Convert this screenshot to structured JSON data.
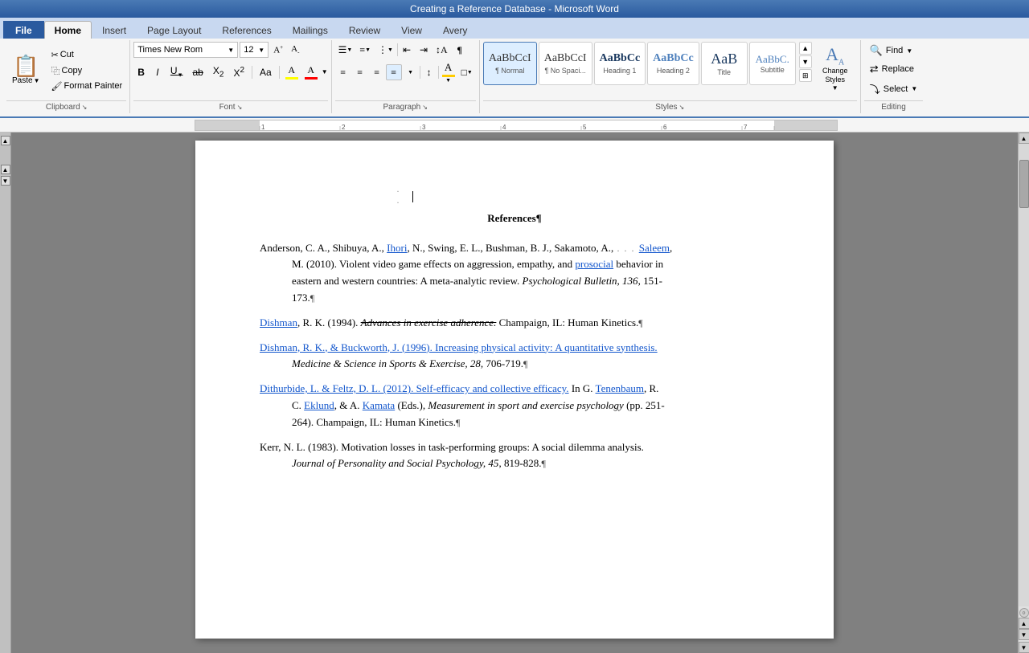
{
  "titlebar": {
    "text": "Creating a Reference Database - Microsoft Word"
  },
  "tabs": [
    {
      "label": "File",
      "active": false,
      "file": true
    },
    {
      "label": "Home",
      "active": true
    },
    {
      "label": "Insert",
      "active": false
    },
    {
      "label": "Page Layout",
      "active": false
    },
    {
      "label": "References",
      "active": false
    },
    {
      "label": "Mailings",
      "active": false
    },
    {
      "label": "Review",
      "active": false
    },
    {
      "label": "View",
      "active": false
    },
    {
      "label": "Avery",
      "active": false
    }
  ],
  "ribbon": {
    "clipboard": {
      "label": "Clipboard",
      "paste_label": "Paste",
      "cut_label": "Cut",
      "copy_label": "Copy",
      "format_painter_label": "Format Painter"
    },
    "font": {
      "label": "Font",
      "family": "Times New Rom",
      "size": "12",
      "bold": "B",
      "italic": "I",
      "underline": "U",
      "strikethrough": "ab",
      "subscript": "X₂",
      "superscript": "X²",
      "clear_format": "Aa",
      "change_case": "Aa",
      "text_highlight": "A",
      "font_color": "A"
    },
    "paragraph": {
      "label": "Paragraph"
    },
    "styles": {
      "label": "Styles",
      "items": [
        {
          "id": "normal",
          "preview": "AaBbCcI",
          "label": "¶ Normal",
          "selected": true
        },
        {
          "id": "no-spacing",
          "preview": "AaBbCcI",
          "label": "¶ No Spaci..."
        },
        {
          "id": "heading1",
          "preview": "AaBbCc",
          "label": "Heading 1"
        },
        {
          "id": "heading2",
          "preview": "AaBbCc",
          "label": "Heading 2"
        },
        {
          "id": "title",
          "preview": "AaB",
          "label": "Title"
        },
        {
          "id": "subtitle",
          "preview": "AaBbC.",
          "label": "Subtitle"
        }
      ],
      "change_styles_label": "Change\nStyles",
      "change_styles_arrow": "▼"
    },
    "editing": {
      "label": "Editing",
      "find_label": "Find",
      "replace_label": "Replace",
      "select_label": "Select"
    }
  },
  "document": {
    "title": "References¶",
    "entries": [
      {
        "id": "entry1",
        "text_parts": [
          {
            "text": "Anderson, C. A., Shibuya, A., Ihori, N., Swing, E. L., Bushman, B. J., Sakamoto, A.,",
            "type": "normal",
            "link": false
          },
          {
            "text": "… Saleem,",
            "type": "dotted",
            "link": false
          }
        ],
        "continuation": "M. (2010). Violent video game effects on aggression, empathy, and ",
        "link_text": "prosocial",
        "after_link": " behavior in",
        "line2": "eastern and western countries: A meta-analytic review. ",
        "journal": "Psychological Bulletin, 136",
        "journal_after": ", 151-",
        "line3": "173.¶"
      }
    ],
    "refs": [
      {
        "id": "dishman1994",
        "line1_pre": "Dishman",
        "line1_mid": ", R. K. (1994). ",
        "line1_italic": "Advances in exercise adherence.",
        "line1_post": " Champaign, IL: Human Kinetics.¶",
        "indent": false
      },
      {
        "id": "dishman1996",
        "line1_pre": "Dishman, R. K., & Buckworth, J. (1996). Increasing physical activity: A quantitative synthesis.",
        "indent": false
      },
      {
        "id": "dishman1996-cont",
        "line1_italic": "Medicine & Science in Sports & Exercise, 28",
        "line1_post": ", 706-719.¶",
        "indent": true
      },
      {
        "id": "dithurbide2012",
        "line1": "Dithurbide, L. & Feltz, D. L. (2012). Self-efficacy and collective efficacy. In G. Tenenbaum, R.",
        "indent": false
      },
      {
        "id": "dithurbide2012-cont",
        "line1_pre": "C. ",
        "line1_link": "Eklund",
        "line1_mid": ", & A. ",
        "line1_link2": "Kamata",
        "line1_post": " (Eds.), ",
        "line1_italic": "Measurement in sport and exercise psychology",
        "line1_after": " (pp. 251-",
        "indent": true
      },
      {
        "id": "dithurbide2012-cont2",
        "line1": "264). Champaign, IL: Human Kinetics.¶",
        "indent": true
      },
      {
        "id": "kerr1983",
        "line1": "Kerr, N. L. (1983). Motivation losses in task-performing groups: A social dilemma analysis.",
        "indent": false
      },
      {
        "id": "kerr1983-cont",
        "line1_italic": "Journal of Personality and Social Psychology, 45",
        "line1_post": ", 819-828.¶",
        "indent": true
      }
    ]
  }
}
